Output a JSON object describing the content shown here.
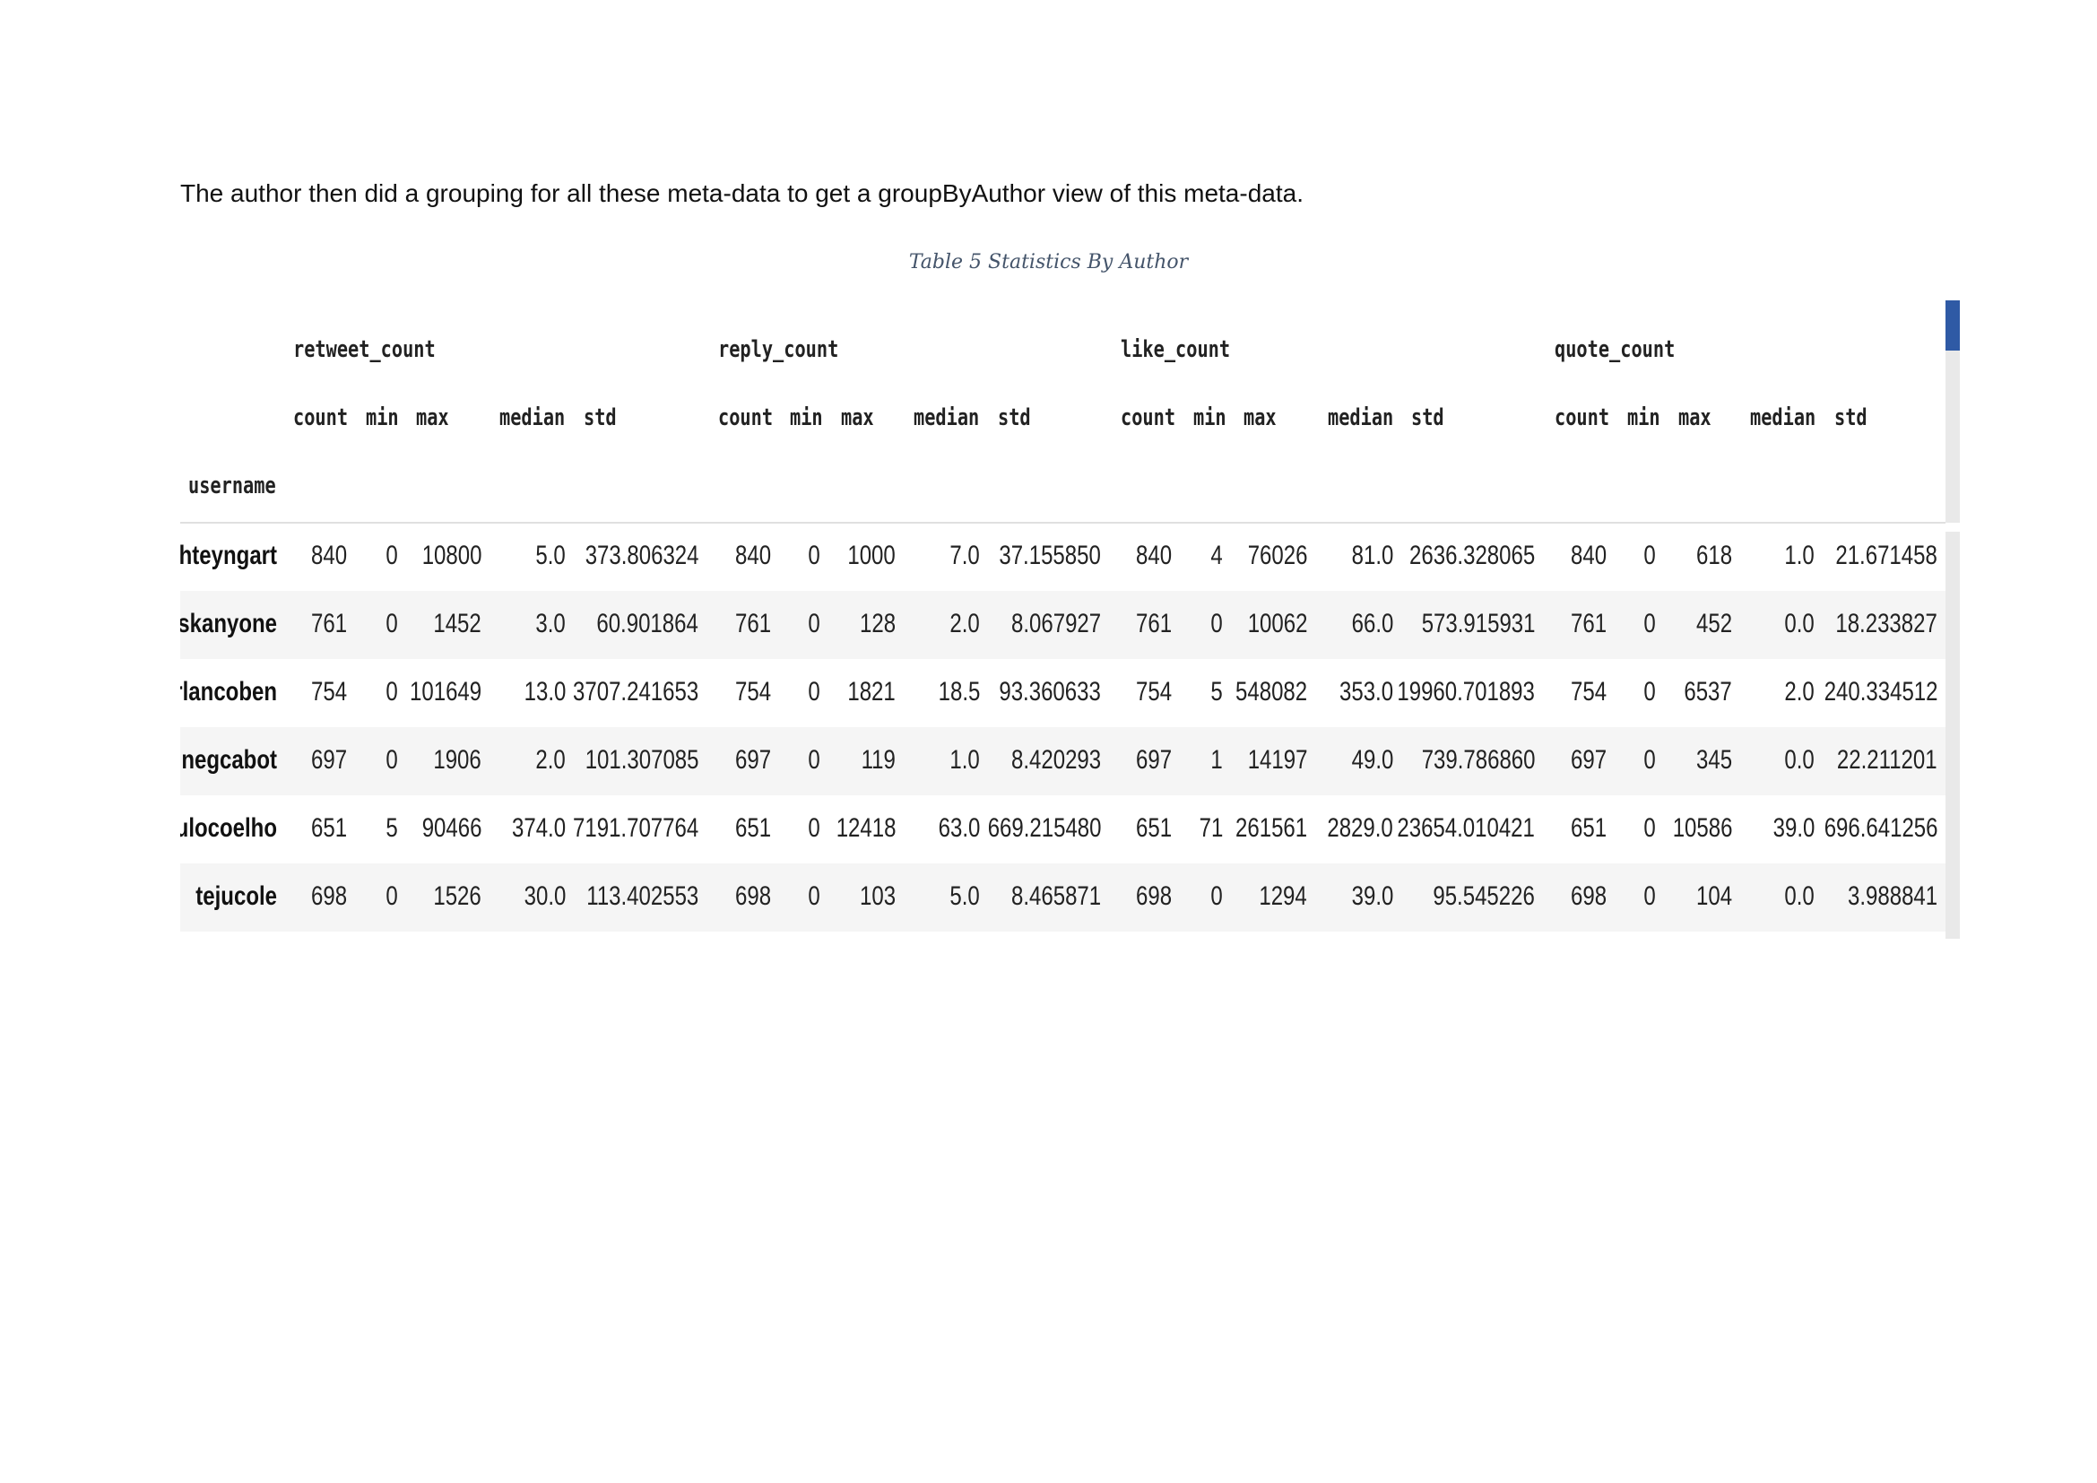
{
  "paragraph": "The author then did a grouping for all these meta-data to get a groupByAuthor view of this meta-data.",
  "caption": "Table 5 Statistics By Author",
  "table": {
    "groups": [
      "retweet_count",
      "reply_count",
      "like_count",
      "quote_count"
    ],
    "stats": [
      "count",
      "min",
      "max",
      "median",
      "std"
    ],
    "index_name": "username",
    "rows": [
      {
        "username": "hteyngart",
        "values": [
          "840",
          "0",
          "10800",
          "5.0",
          "373.806324",
          "840",
          "0",
          "1000",
          "7.0",
          "37.155850",
          "840",
          "4",
          "76026",
          "81.0",
          "2636.328065",
          "840",
          "0",
          "618",
          "1.0",
          "21.671458"
        ]
      },
      {
        "username": "skanyone",
        "values": [
          "761",
          "0",
          "1452",
          "3.0",
          "60.901864",
          "761",
          "0",
          "128",
          "2.0",
          "8.067927",
          "761",
          "0",
          "10062",
          "66.0",
          "573.915931",
          "761",
          "0",
          "452",
          "0.0",
          "18.233827"
        ]
      },
      {
        "username": "rlancoben",
        "values": [
          "754",
          "0",
          "101649",
          "13.0",
          "3707.241653",
          "754",
          "0",
          "1821",
          "18.5",
          "93.360633",
          "754",
          "5",
          "548082",
          "353.0",
          "19960.701893",
          "754",
          "0",
          "6537",
          "2.0",
          "240.334512"
        ]
      },
      {
        "username": "negcabot",
        "values": [
          "697",
          "0",
          "1906",
          "2.0",
          "101.307085",
          "697",
          "0",
          "119",
          "1.0",
          "8.420293",
          "697",
          "1",
          "14197",
          "49.0",
          "739.786860",
          "697",
          "0",
          "345",
          "0.0",
          "22.211201"
        ]
      },
      {
        "username": "ulocoelho",
        "values": [
          "651",
          "5",
          "90466",
          "374.0",
          "7191.707764",
          "651",
          "0",
          "12418",
          "63.0",
          "669.215480",
          "651",
          "71",
          "261561",
          "2829.0",
          "23654.010421",
          "651",
          "0",
          "10586",
          "39.0",
          "696.641256"
        ]
      },
      {
        "username": "tejucole",
        "values": [
          "698",
          "0",
          "1526",
          "30.0",
          "113.402553",
          "698",
          "0",
          "103",
          "5.0",
          "8.465871",
          "698",
          "0",
          "1294",
          "39.0",
          "95.545226",
          "698",
          "0",
          "104",
          "0.0",
          "3.988841"
        ]
      }
    ]
  },
  "colors": {
    "scroll_thumb": "#2f5aa5",
    "row_band": "#f5f5f5",
    "caption": "#44546a"
  }
}
